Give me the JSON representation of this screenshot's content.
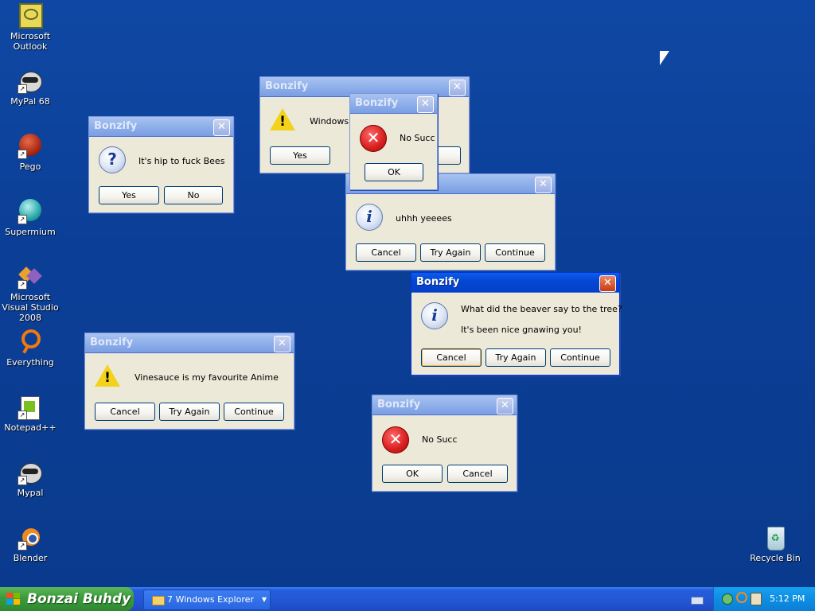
{
  "desktop": {
    "icons": [
      {
        "label": "Microsoft Outlook",
        "icon": "outlook-icon"
      },
      {
        "label": "MyPal 68",
        "icon": "raccoon-icon"
      },
      {
        "label": "Pego",
        "icon": "pego-icon"
      },
      {
        "label": "Supermium",
        "icon": "supermium-icon"
      },
      {
        "label": "Microsoft Visual Studio 2008",
        "icon": "visual-studio-icon"
      },
      {
        "label": "Everything",
        "icon": "everything-icon"
      },
      {
        "label": "Notepad++",
        "icon": "notepad-plus-plus-icon"
      },
      {
        "label": "Mypal",
        "icon": "raccoon-icon"
      },
      {
        "label": "Blender",
        "icon": "blender-icon"
      },
      {
        "label": "Recycle Bin",
        "icon": "recycle-bin-icon"
      }
    ]
  },
  "dialogs": {
    "d1": {
      "title": "Bonzify",
      "message": "It's hip to fuck Bees",
      "icon": "question-icon",
      "buttons": [
        "Yes",
        "No"
      ]
    },
    "d2": {
      "title": "Bonzify",
      "message": "Windows W",
      "icon": "warning-icon",
      "buttons": [
        "Yes"
      ]
    },
    "d3": {
      "title": "Bonzify",
      "message": "No Succ",
      "icon": "error-icon",
      "buttons": [
        "OK"
      ]
    },
    "d4": {
      "title": "",
      "message": "uhhh yeeees",
      "icon": "info-icon",
      "buttons": [
        "Cancel",
        "Try Again",
        "Continue"
      ]
    },
    "d5": {
      "title": "Bonzify",
      "message": "What did the beaver say to the tree?",
      "message2": "It's been nice gnawing you!",
      "icon": "info-icon",
      "buttons": [
        "Cancel",
        "Try Again",
        "Continue"
      ]
    },
    "d6": {
      "title": "Bonzify",
      "message": "Vinesauce is my favourite Anime",
      "icon": "warning-icon",
      "buttons": [
        "Cancel",
        "Try Again",
        "Continue"
      ]
    },
    "d7": {
      "title": "Bonzify",
      "message": "No Succ",
      "icon": "error-icon",
      "buttons": [
        "OK",
        "Cancel"
      ]
    }
  },
  "taskbar": {
    "start_label": "Bonzai Buhdy",
    "task_button": "7 Windows Explorer",
    "clock": "5:12 PM"
  }
}
